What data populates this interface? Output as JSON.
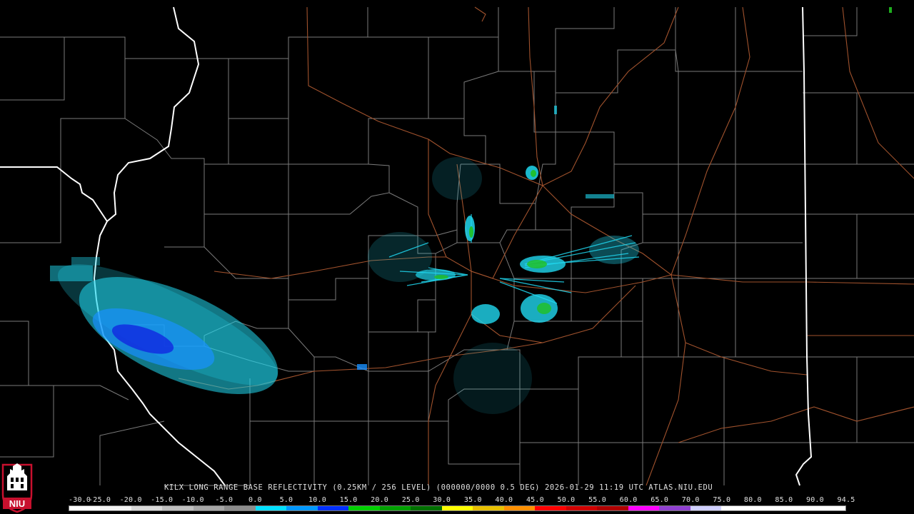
{
  "product_caption": "KILX LONG RANGE BASE REFLECTIVITY (0.25KM / 256 LEVEL) (000000/0000 0.5 DEG) 2026-01-29 11:19 UTC  ATLAS.NIU.EDU",
  "logo_text": "NIU",
  "scale": {
    "labels": [
      "-30.0",
      "-25.0",
      "-20.0",
      "-15.0",
      "-10.0",
      "-5.0",
      "0.0",
      "5.0",
      "10.0",
      "15.0",
      "20.0",
      "25.0",
      "30.0",
      "35.0",
      "40.0",
      "45.0",
      "50.0",
      "55.0",
      "60.0",
      "65.0",
      "70.0",
      "75.0",
      "80.0",
      "85.0",
      "90.0",
      "94.5"
    ],
    "colors": [
      "#ffffff",
      "#f2f2f2",
      "#d8d8d8",
      "#bfbfbf",
      "#a6a6a6",
      "#8c8c8c",
      "#00e0ff",
      "#0098ff",
      "#0030ff",
      "#00d000",
      "#00a000",
      "#007000",
      "#ffff00",
      "#e8c000",
      "#ff9000",
      "#ff0000",
      "#d00000",
      "#b00000",
      "#ff00ff",
      "#9040d0",
      "#d0d0ff",
      "#ffffff",
      "#ffffff",
      "#ffffff",
      "#ffffff"
    ]
  },
  "colors": {
    "county_lines": "#7a7a7a",
    "state_lines": "#ffffff",
    "highway_lines": "#a0522d",
    "light_echo": "#20d8f0",
    "mid_echo": "#1890ff",
    "heavy_echo": "#1020e0",
    "green_echo": "#20c020"
  }
}
